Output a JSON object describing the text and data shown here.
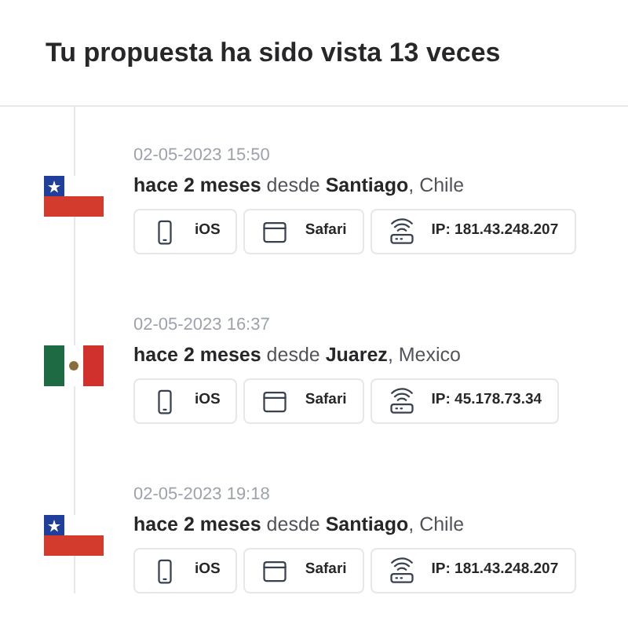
{
  "header": {
    "title": "Tu propuesta ha sido vista 13 veces"
  },
  "views": [
    {
      "kind": "chile",
      "date": "02-05-2023 15:50",
      "summary": "**hace 2 meses** desde **Santiago**, Chile",
      "chips": [
        {
          "kind": "device",
          "label": "iOS"
        },
        {
          "kind": "browser",
          "label": "Safari"
        },
        {
          "kind": "ip",
          "label": "IP: 181.43.248.207"
        }
      ]
    },
    {
      "kind": "mexico",
      "date": "02-05-2023 16:37",
      "summary": "**hace 2 meses** desde **Juarez**, Mexico",
      "chips": [
        {
          "kind": "device",
          "label": "iOS"
        },
        {
          "kind": "browser",
          "label": "Safari"
        },
        {
          "kind": "ip",
          "label": "IP: 45.178.73.34"
        }
      ]
    },
    {
      "kind": "chile",
      "date": "02-05-2023 19:18",
      "summary": "**hace 2 meses** desde **Santiago**, Chile",
      "chips": [
        {
          "kind": "device",
          "label": "iOS"
        },
        {
          "kind": "browser",
          "label": "Safari"
        },
        {
          "kind": "ip",
          "label": "IP: 181.43.248.207"
        }
      ]
    }
  ]
}
